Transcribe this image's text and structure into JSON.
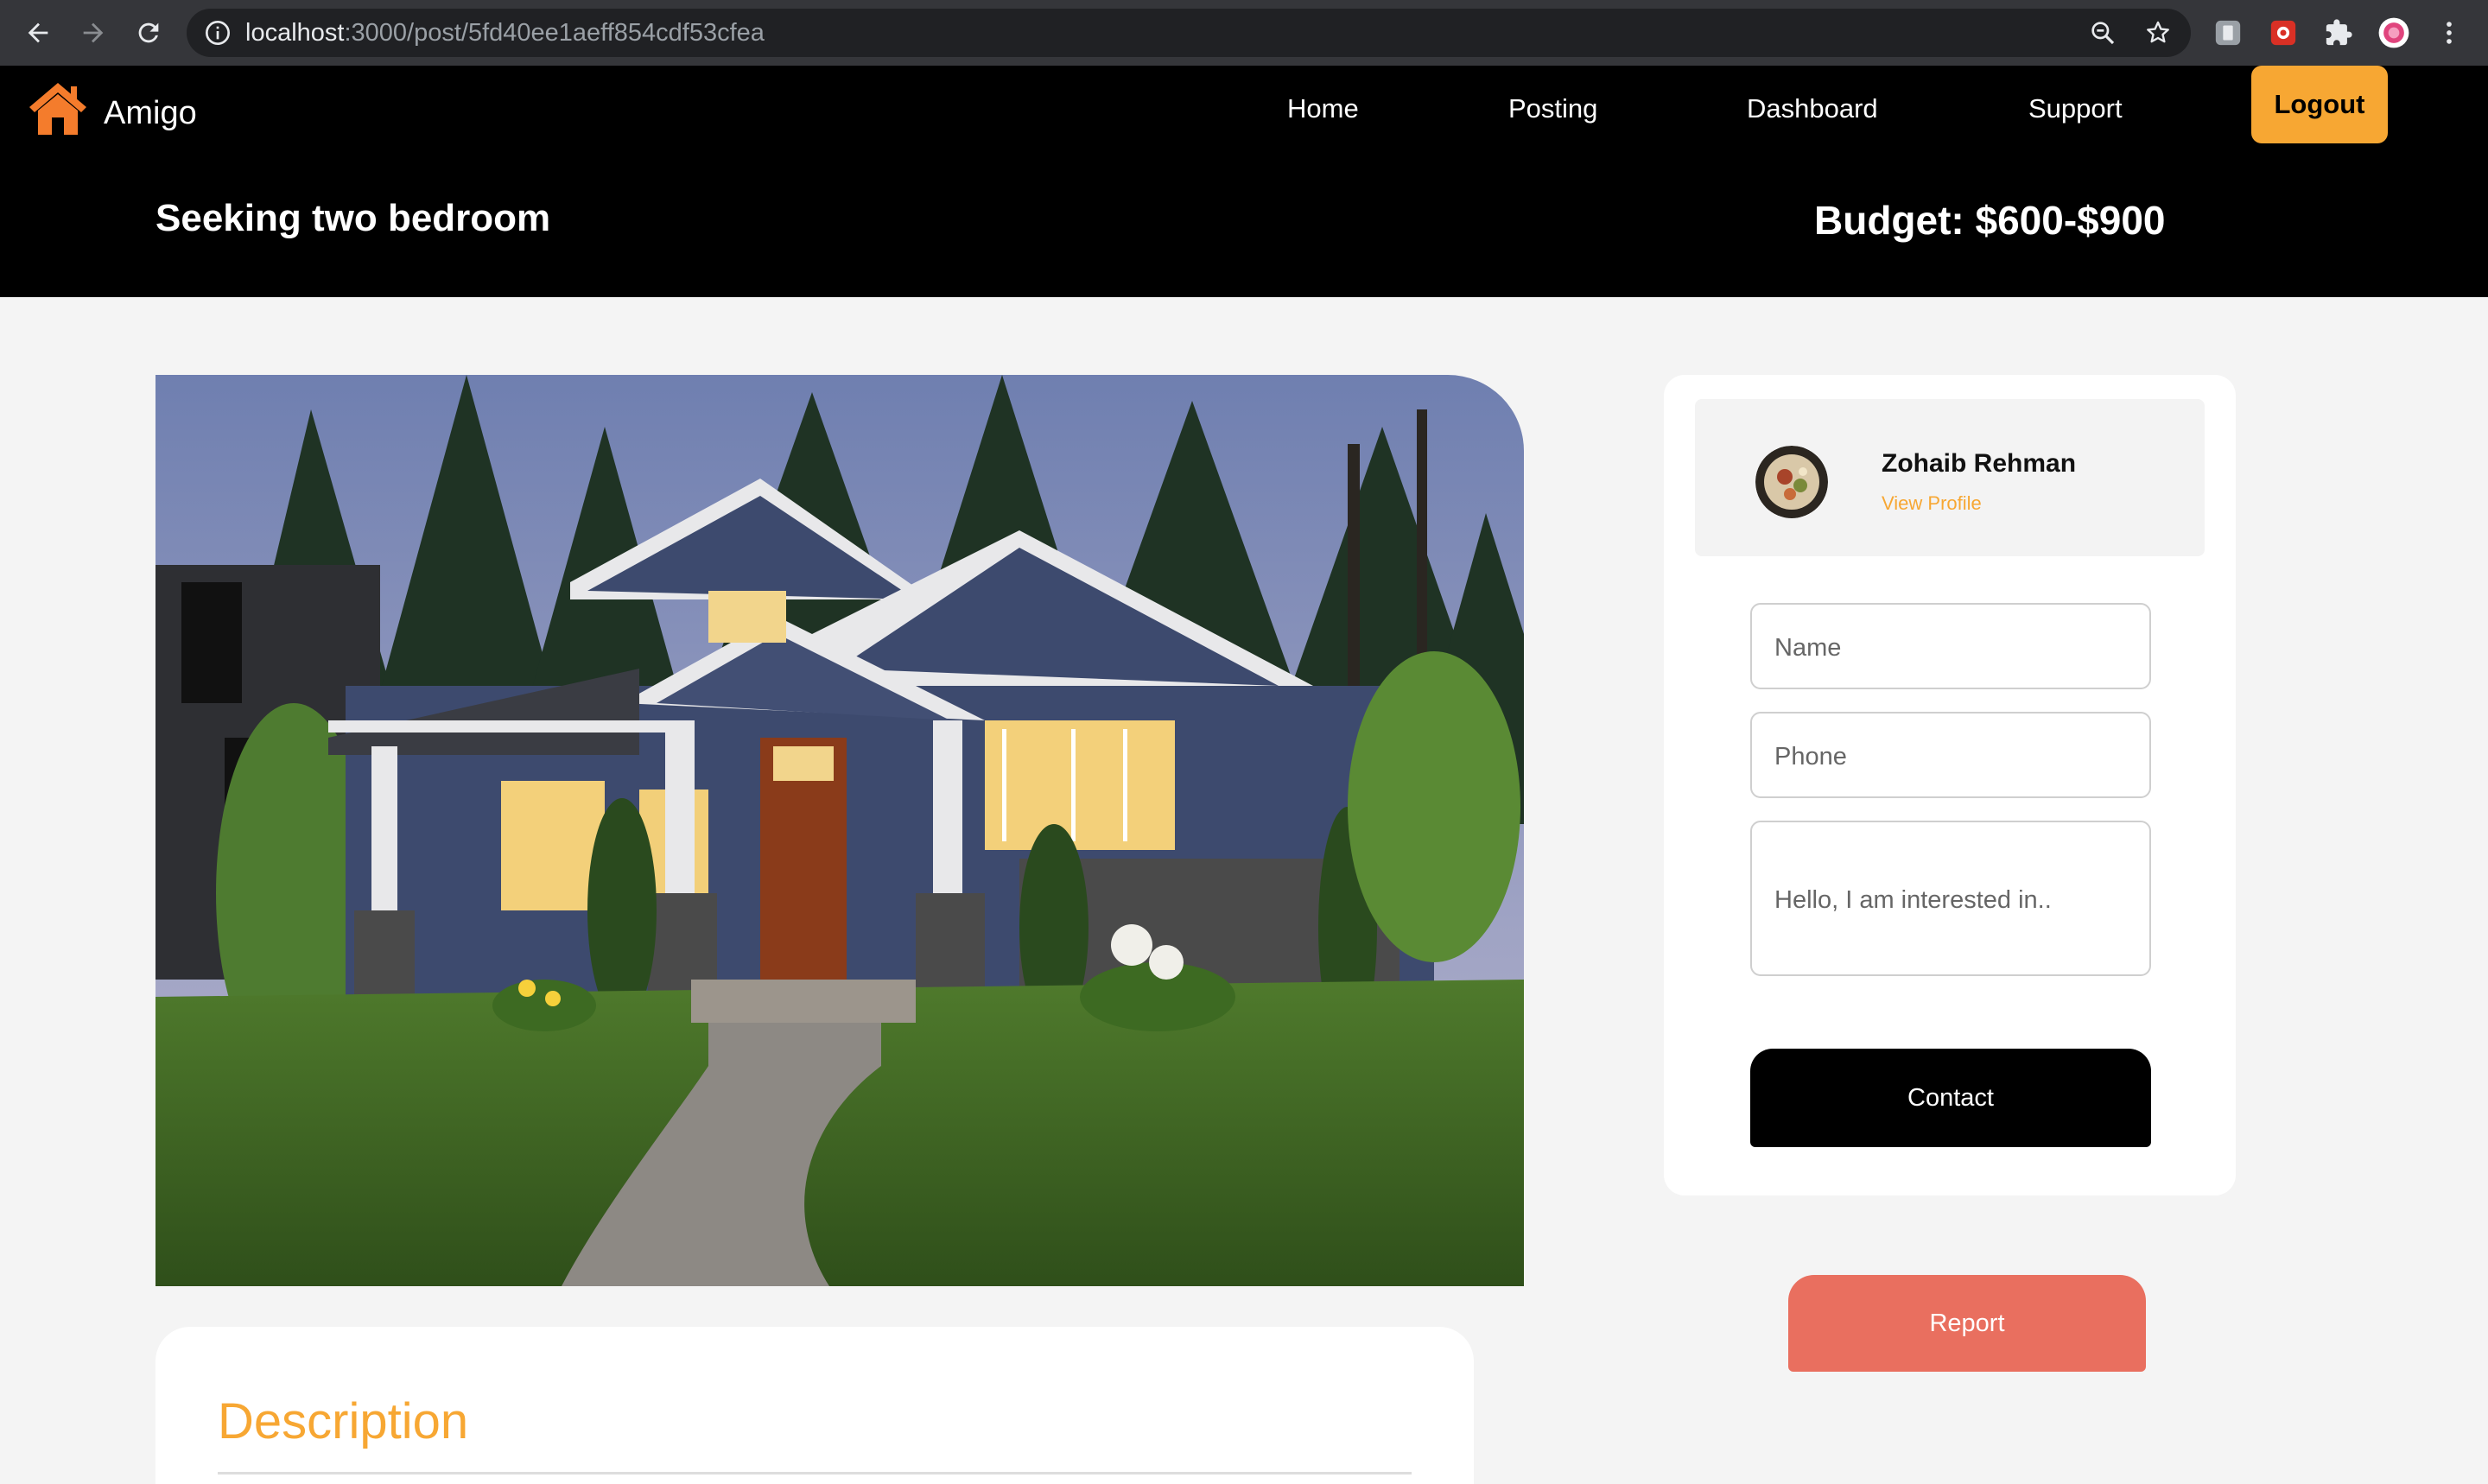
{
  "browser": {
    "url_host": "localhost",
    "url_rest": ":3000/post/5fd40ee1aeff854cdf53cfea"
  },
  "header": {
    "brand": "Amigo",
    "nav": [
      "Home",
      "Posting",
      "Dashboard",
      "Support"
    ],
    "logout_label": "Logout",
    "post_title": "Seeking two bedroom",
    "budget": "Budget: $600-$900"
  },
  "contact": {
    "name": "Zohaib Rehman",
    "view_profile": "View Profile",
    "name_placeholder": "Name",
    "phone_placeholder": "Phone",
    "message_placeholder": "Hello, I am interested in..",
    "contact_label": "Contact"
  },
  "report_label": "Report",
  "description": {
    "title": "Description"
  },
  "colors": {
    "accent": "#f7a733",
    "report": "#e96f5f",
    "header_bg": "#000000",
    "page_bg": "#f4f4f4"
  },
  "icons": [
    "back-arrow-icon",
    "forward-arrow-icon",
    "reload-icon",
    "info-icon",
    "zoom-icon",
    "star-icon",
    "extension-icon",
    "puzzle-icon",
    "profile-icon",
    "kebab-menu-icon",
    "house-logo-icon"
  ]
}
